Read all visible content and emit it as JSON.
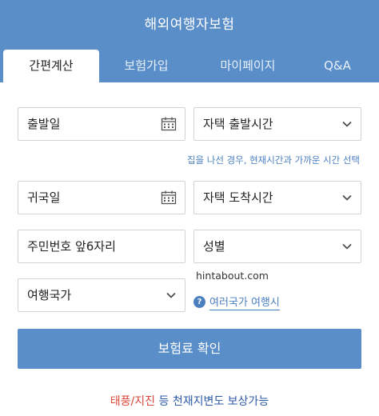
{
  "header": {
    "title": "해외여행자보험"
  },
  "tabs": [
    {
      "label": "간편계산"
    },
    {
      "label": "보험가입"
    },
    {
      "label": "마이페이지"
    },
    {
      "label": "Q&A"
    }
  ],
  "form": {
    "departure_date": "출발일",
    "departure_time": "자택 출발시간",
    "hint": "집을 나선 경우, 현재시간과 가까운 시간 선택",
    "return_date": "귀국일",
    "arrival_time": "자택 도착시간",
    "id_number": "주민번호 앞6자리",
    "gender": "성별",
    "country": "여행국가",
    "watermark": "hintabout.com",
    "multi_country": "여러국가 여행시"
  },
  "confirm_button": "보험료 확인",
  "notice": {
    "highlight": "태풍/지진",
    "rest": " 등 천재지변도 보상가능"
  },
  "colors": {
    "accent": "#5a8ec9",
    "link": "#4a7fc0",
    "alert": "#d9463a"
  }
}
